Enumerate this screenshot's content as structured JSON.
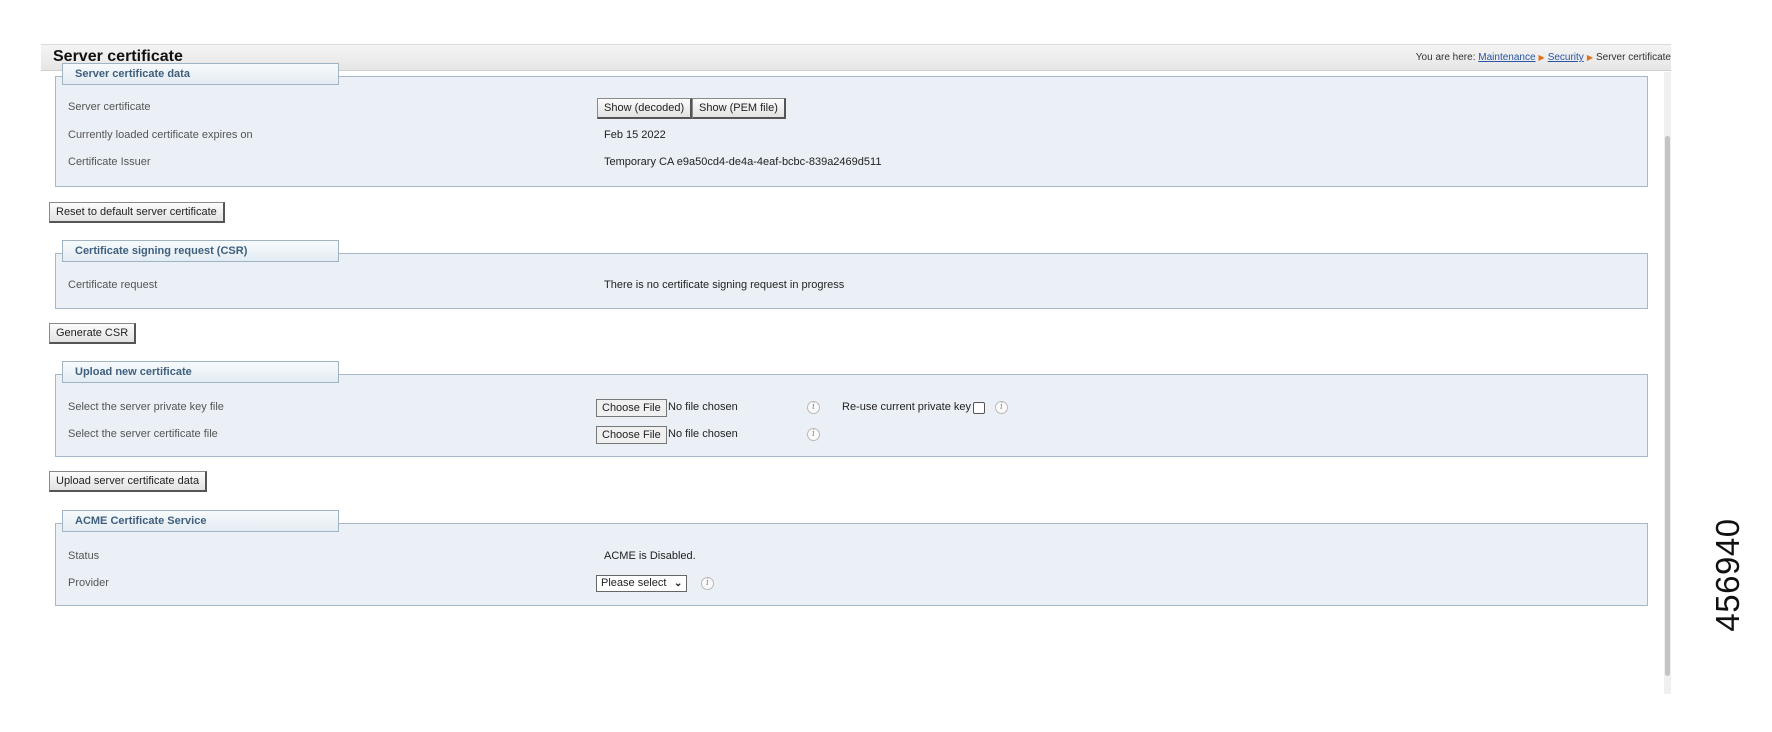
{
  "page": {
    "title": "Server certificate",
    "breadcrumb": {
      "prefix": "You are here:",
      "items": [
        "Maintenance",
        "Security"
      ],
      "current": "Server certificate"
    }
  },
  "sections": {
    "server_cert_data": {
      "legend": "Server certificate data",
      "rows": {
        "server_certificate": {
          "label": "Server certificate",
          "btn_decoded": "Show (decoded)",
          "btn_pem": "Show (PEM file)"
        },
        "expires": {
          "label": "Currently loaded certificate expires on",
          "value": "Feb 15 2022"
        },
        "issuer": {
          "label": "Certificate Issuer",
          "value": "Temporary CA e9a50cd4-de4a-4eaf-bcbc-839a2469d511"
        }
      }
    },
    "csr": {
      "legend": "Certificate signing request (CSR)",
      "rows": {
        "request": {
          "label": "Certificate request",
          "value": "There is no certificate signing request in progress"
        }
      }
    },
    "upload": {
      "legend": "Upload new certificate",
      "rows": {
        "private_key": {
          "label": "Select the server private key file",
          "choose": "Choose File",
          "status": "No file chosen",
          "reuse_label": "Re-use current private key",
          "reuse_checked": false
        },
        "cert_file": {
          "label": "Select the server certificate file",
          "choose": "Choose File",
          "status": "No file chosen"
        }
      }
    },
    "acme": {
      "legend": "ACME Certificate Service",
      "rows": {
        "status": {
          "label": "Status",
          "value": "ACME is Disabled."
        },
        "provider": {
          "label": "Provider",
          "selected": "Please select"
        }
      }
    }
  },
  "buttons": {
    "reset_default": "Reset to default server certificate",
    "generate_csr": "Generate CSR",
    "upload_data": "Upload server certificate data"
  },
  "figure_id": "456940",
  "colors": {
    "section_bg": "#eaf0f5",
    "legend_text": "#3f5f7d",
    "link": "#2a55a3",
    "breadcrumb_arrow": "#e0701b"
  },
  "icons": {
    "info": "info-icon",
    "dropdown": "chevron-down-icon",
    "breadcrumb_separator": "triangle-right-icon"
  }
}
